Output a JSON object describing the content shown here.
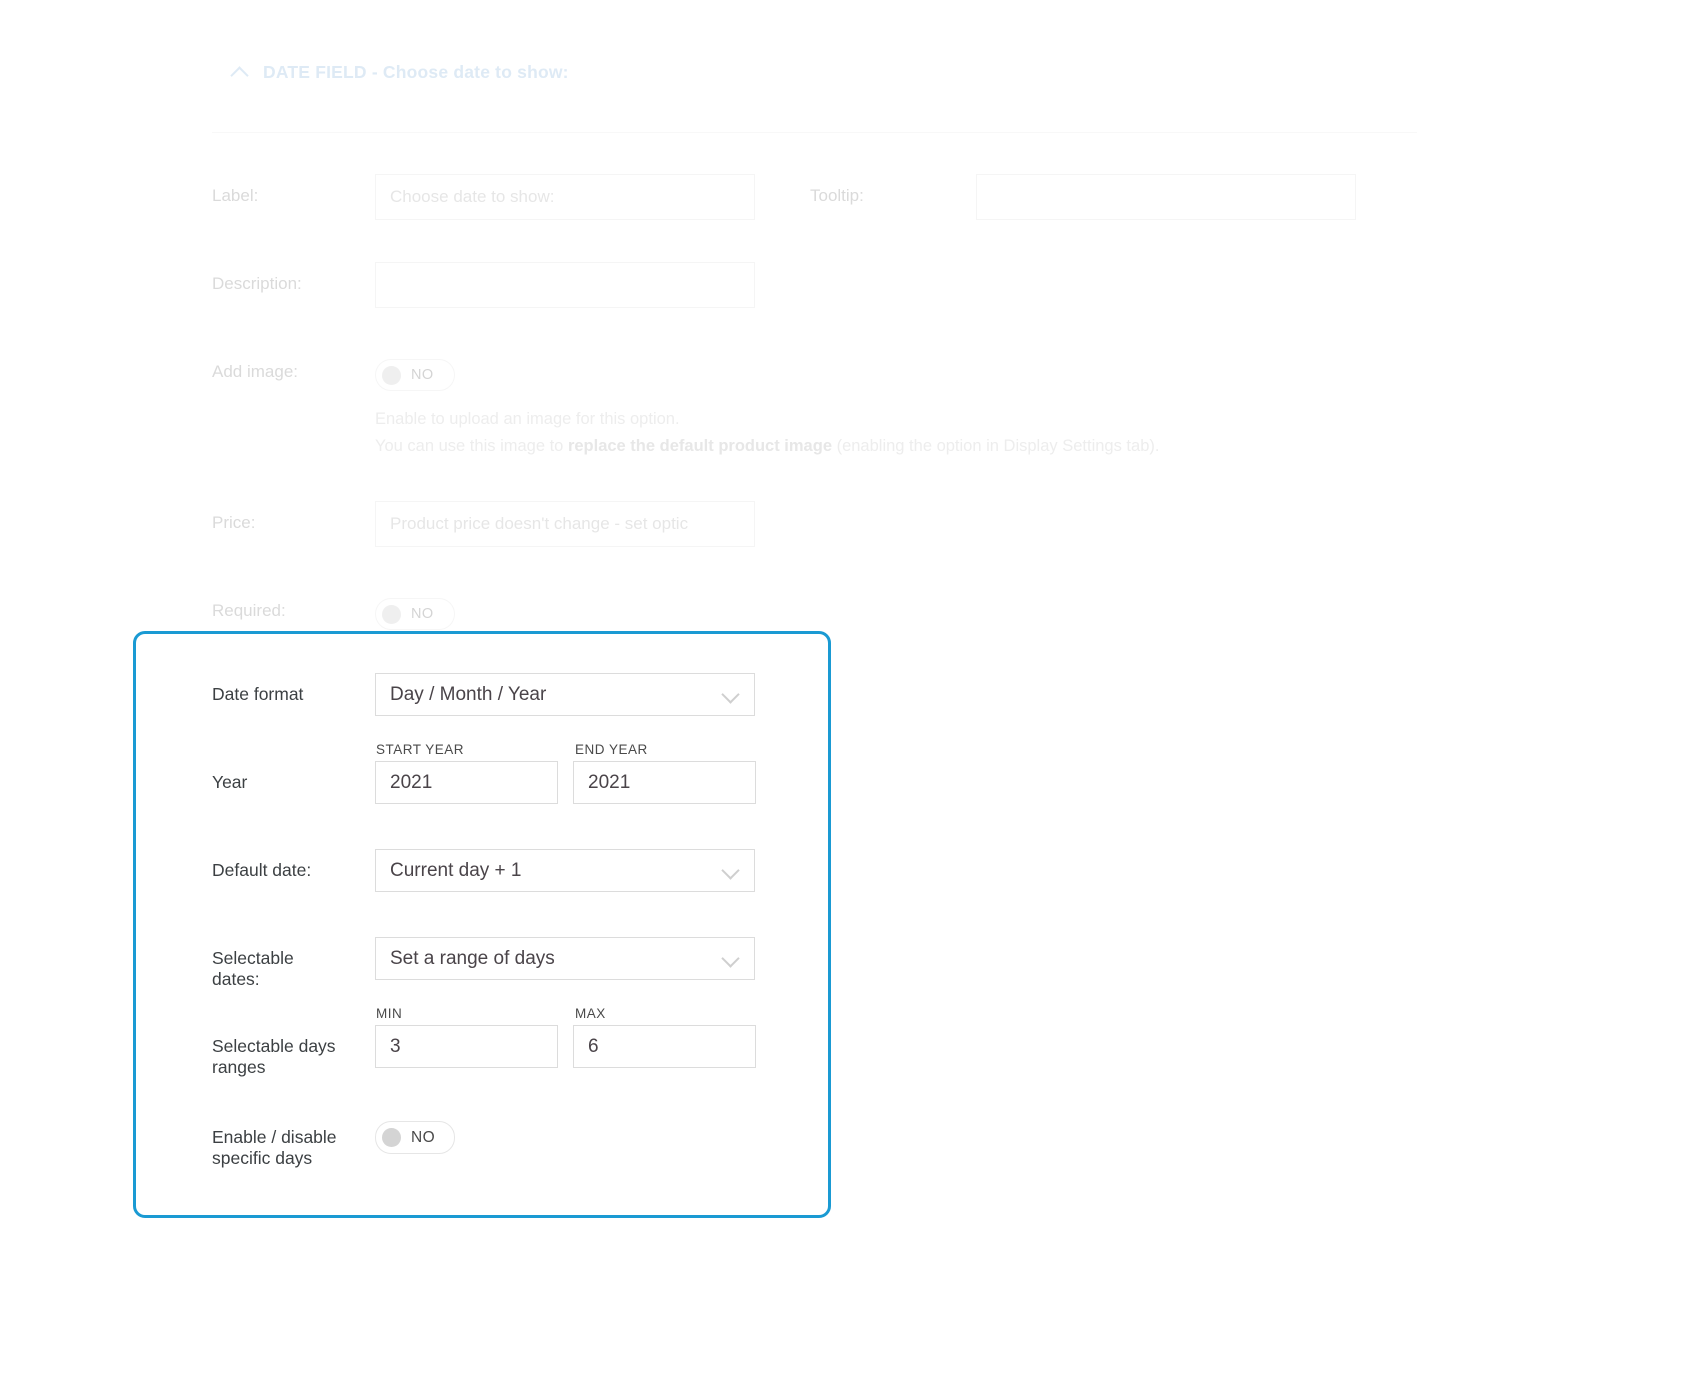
{
  "panel": {
    "collapse_icon": "chevron-up-icon",
    "title": "DATE FIELD - Choose date to show:"
  },
  "basic_fields": {
    "label_label": "Label:",
    "label_placeholder": "Choose date to show:",
    "tooltip_label": "Tooltip:",
    "tooltip_value": "",
    "description_label": "Description:",
    "description_value": "",
    "add_image_label": "Add image:",
    "add_image_toggle": "NO",
    "note_line1": "Enable to upload an image for this option.",
    "note_line2_prefix": "You can use this image to ",
    "note_line2_bold": "replace the default product image",
    "note_line2_suffix": " (enabling the option in Display Settings tab).",
    "price_label": "Price:",
    "price_placeholder": "Product price doesn't change - set optic",
    "required_label": "Required:",
    "required_toggle": "NO"
  },
  "date_settings": {
    "highlight_color": "#1a9ad3",
    "date_format_label": "Date format",
    "date_format_value": "Day / Month / Year",
    "year_label": "Year",
    "start_year_caption": "START YEAR",
    "start_year_value": "2021",
    "end_year_caption": "END YEAR",
    "end_year_value": "2021",
    "default_date_label": "Default date:",
    "default_date_value": "Current day + 1",
    "selectable_dates_label": "Selectable\ndates:",
    "selectable_dates_value": "Set a range of days",
    "selectable_ranges_label": "Selectable days\nranges",
    "min_caption": "MIN",
    "min_value": "3",
    "max_caption": "MAX",
    "max_value": "6",
    "specific_days_label": "Enable / disable\nspecific days",
    "specific_days_toggle": "NO"
  }
}
